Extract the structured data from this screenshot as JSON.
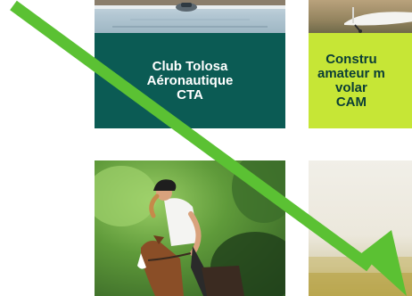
{
  "cards": [
    {
      "id": "club-tolosa",
      "lines": [
        "Club Tolosa",
        "Aéronautique",
        "CTA"
      ],
      "caption_bg": "#0b5b54",
      "caption_color": "#ffffff"
    },
    {
      "id": "construction-amateur",
      "lines": [
        "Constru",
        "amateur m",
        "volar",
        "CAM"
      ],
      "caption_bg": "#c6e636",
      "caption_color": "#0a3d36"
    },
    {
      "id": "horse-riding",
      "photo": "rider-on-horse"
    },
    {
      "id": "blurred-landscape",
      "photo": "blurred-field"
    }
  ],
  "overlay": {
    "type": "arrow",
    "color": "#5bc133",
    "direction": "top-left-to-bottom-right"
  }
}
